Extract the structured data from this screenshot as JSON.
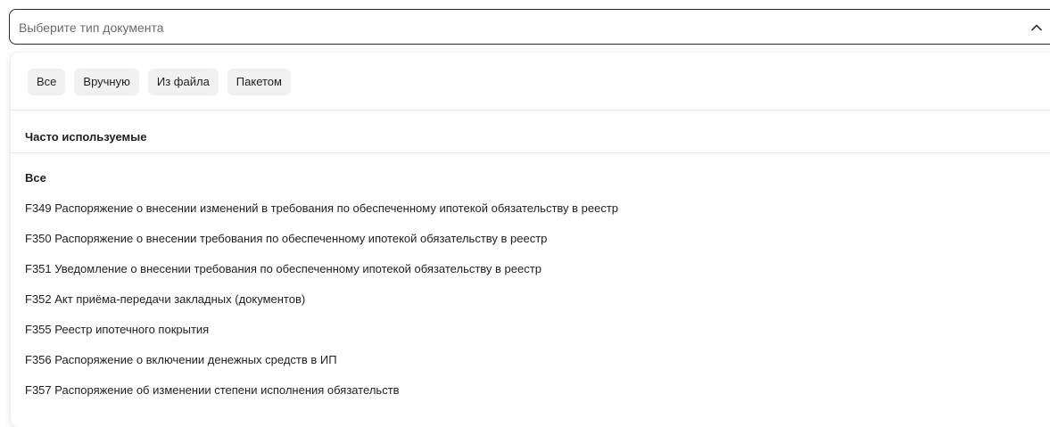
{
  "select": {
    "placeholder": "Выберите тип документа",
    "chevron_icon": "chevron-up-icon"
  },
  "filters": [
    {
      "label": "Все"
    },
    {
      "label": "Вручную"
    },
    {
      "label": "Из файла"
    },
    {
      "label": "Пакетом"
    }
  ],
  "section": {
    "title": "Часто используемые"
  },
  "options": [
    {
      "label": "Все"
    },
    {
      "label": "F349 Распоряжение о внесении изменений в требования по обеспеченному ипотекой обязательству в реестр"
    },
    {
      "label": "F350 Распоряжение о внесении требования по обеспеченному ипотекой обязательству в реестр"
    },
    {
      "label": "F351 Уведомление о внесении требования по обеспеченному ипотекой обязательству в реестр"
    },
    {
      "label": "F352 Акт приёма-передачи закладных (документов)"
    },
    {
      "label": "F355 Реестр ипотечного покрытия"
    },
    {
      "label": "F356 Распоряжение о включении денежных средств в ИП"
    },
    {
      "label": "F357 Распоряжение об изменении степени исполнения обязательств"
    }
  ]
}
